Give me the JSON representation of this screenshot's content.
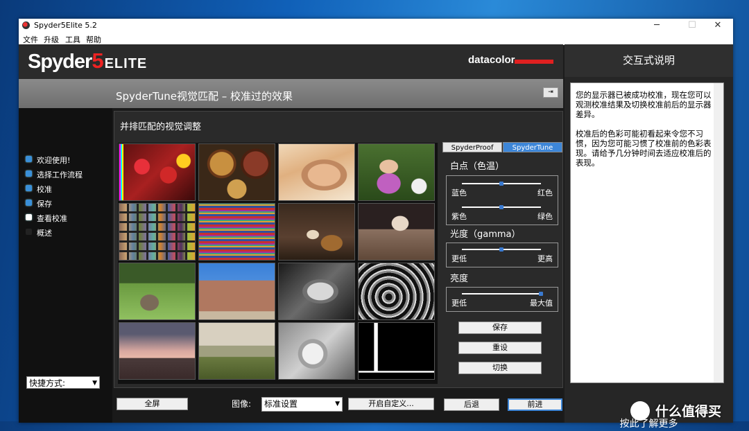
{
  "window": {
    "title": "Spyder5Elite 5.2",
    "minimize": "─",
    "maximize": "☐",
    "close": "✕"
  },
  "menu": [
    "文件",
    "升级",
    "工具",
    "帮助"
  ],
  "logo": {
    "main": "Spyder",
    "num": "5",
    "edition": "ELITE"
  },
  "brand": "datacolor",
  "page_title": "SpyderTune视觉匹配 – 校准过的效果",
  "pin_glyph": "⇥",
  "panel_title": "并排匹配的视觉调整",
  "nav": [
    {
      "label": "欢迎使用!",
      "state": "done"
    },
    {
      "label": "选择工作流程",
      "state": "done"
    },
    {
      "label": "校准",
      "state": "done"
    },
    {
      "label": "保存",
      "state": "done"
    },
    {
      "label": "查看校准",
      "state": "current"
    },
    {
      "label": "概述",
      "state": "pending"
    }
  ],
  "shortcut": {
    "label": "快捷方式:",
    "arrow": "▼"
  },
  "tabs": {
    "proof": "SpyderProof",
    "tune": "SpyderTune"
  },
  "white_point": {
    "title": "白点（色温）",
    "slider1": {
      "left": "蓝色",
      "right": "红色",
      "value": 0.5
    },
    "slider2": {
      "left": "紫色",
      "right": "绿色",
      "value": 0.5
    }
  },
  "gamma": {
    "title": "光度（gamma）",
    "left": "更低",
    "right": "更高",
    "value": 0.5
  },
  "brightness": {
    "title": "亮度",
    "left": "更低",
    "right": "最大值",
    "value": 1.0
  },
  "buttons": {
    "save": "保存",
    "reset": "重设",
    "toggle": "切换"
  },
  "bottom": {
    "fullscreen": "全屏",
    "image_label": "图像:",
    "image_select": "标准设置",
    "custom": "开启自定义...",
    "back": "后退",
    "next": "前进"
  },
  "help": {
    "header": "交互式说明",
    "p1": "您的显示器已被成功校准，现在您可以观测校准结果及切换校准前后的显示器差异。",
    "p2": "校准后的色彩可能初看起来令您不习惯，因为您可能习惯了校准前的色彩表现。请给予几分钟时间去适应校准后的表现。",
    "footer": "按此了解更多"
  },
  "watermark": "什么值得买"
}
